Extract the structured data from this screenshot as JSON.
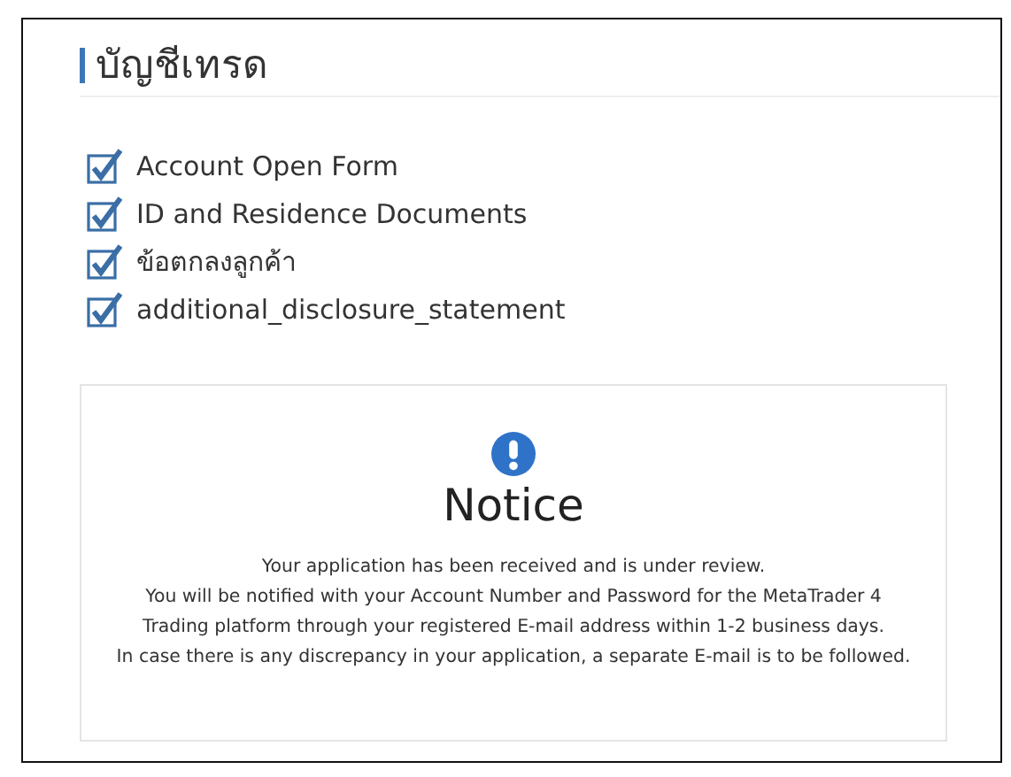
{
  "title": "บัญชีเทรด",
  "documents": [
    {
      "label": "Account Open Form",
      "checked": true
    },
    {
      "label": "ID and Residence Documents",
      "checked": true
    },
    {
      "label": "ข้อตกลงลูกค้า",
      "checked": true
    },
    {
      "label": "additional_disclosure_statement",
      "checked": true
    }
  ],
  "notice": {
    "heading": "Notice",
    "paragraphs": [
      "Your application has been received and is under review.",
      "You will be notified with your Account Number and Password for the MetaTrader 4 Trading platform through your registered E-mail address within 1-2 business days.",
      "In case there is any discrepancy in your application, a separate E-mail is to be followed."
    ]
  }
}
